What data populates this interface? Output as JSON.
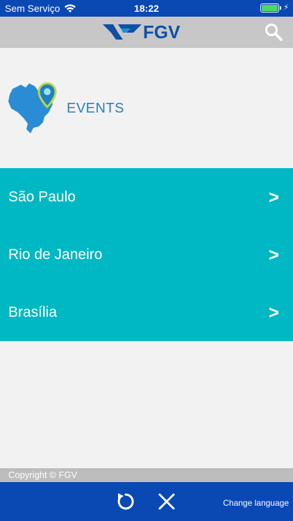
{
  "status_bar": {
    "carrier": "Sem Serviço",
    "time": "18:22",
    "battery_level": 1.0,
    "icons": [
      "wifi-icon",
      "battery-icon",
      "charging-bolt-icon"
    ]
  },
  "header": {
    "logo_text": "FGV",
    "search_icon": "search-icon"
  },
  "events": {
    "title": "EVENTS",
    "icon": "brazil-map-pin-icon"
  },
  "cities": [
    {
      "label": "São Paulo",
      "arrow": ">"
    },
    {
      "label": "Rio de Janeiro",
      "arrow": ">"
    },
    {
      "label": "Brasília",
      "arrow": ">"
    }
  ],
  "footer": {
    "copyright": "Copyright © FGV",
    "change_language": "Change language",
    "refresh_icon": "refresh-icon",
    "close_icon": "close-icon"
  },
  "colors": {
    "brand_blue": "#0a48b4",
    "teal": "#00b8c3",
    "header_gray": "#c7c7c7",
    "events_blue": "#2a7fbd"
  }
}
